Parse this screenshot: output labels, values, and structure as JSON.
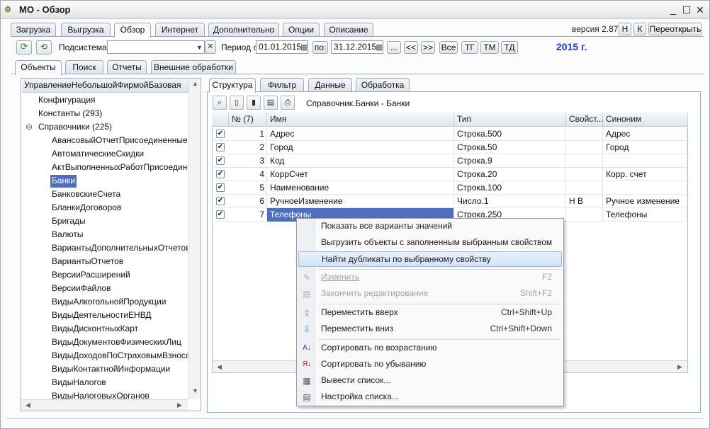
{
  "window": {
    "title": "МО - Обзор",
    "min": "_",
    "max": "☐",
    "close": "✕"
  },
  "top_tabs": [
    "Загрузка",
    "Выгрузка",
    "Обзор",
    "Интернет",
    "Дополнительно",
    "Опции",
    "Описание"
  ],
  "top_tabs_active": 2,
  "version": {
    "label": "версия 2.87",
    "h_button": "Н",
    "k_button": "К",
    "reopen_button": "Переоткрыть"
  },
  "toolbar": {
    "subsystem_label": "Подсистема:",
    "subsystem_value": "",
    "period_label": "Период с:",
    "date_from": "01.01.2015",
    "to_label": "по:",
    "date_to": "31.12.2015",
    "ellipsis": "...",
    "prev": "<<",
    "next": ">>",
    "all": "Все",
    "tg": "ТГ",
    "tm": "ТМ",
    "td": "ТД",
    "year_text": "2015 г."
  },
  "sub_tabs": [
    "Объекты",
    "Поиск",
    "Отчеты",
    "Внешние обработки"
  ],
  "tree": {
    "header": "УправлениеНебольшойФирмойБазовая",
    "root_items": [
      "Конфигурация",
      "Константы (293)",
      "Справочники (225)"
    ],
    "expander": "⊖",
    "children": [
      "АвансовыйОтчетПрисоединенныеФа",
      "АвтоматическиеСкидки",
      "АктВыполненныхРаботПрисоединенн",
      "Банки",
      "БанковскиеСчета",
      "БланкиДоговоров",
      "Бригады",
      "Валюты",
      "ВариантыДополнительныхОтчетов",
      "ВариантыОтчетов",
      "ВерсииРасширений",
      "ВерсииФайлов",
      "ВидыАлкогольнойПродукции",
      "ВидыДеятельностиЕНВД",
      "ВидыДисконтныхКарт",
      "ВидыДокументовФизическихЛиц",
      "ВидыДоходовПоСтраховымВзносам",
      "ВидыКонтактнойИнформации",
      "ВидыНалогов",
      "ВидыНалоговыхОрганов"
    ],
    "selected_index": 3
  },
  "right_tabs": [
    "Структура",
    "Фильтр",
    "Данные",
    "Обработка"
  ],
  "object_path": "Справочник.Банки - Банки",
  "grid": {
    "columns": [
      "№ (7)",
      "Имя",
      "Тип",
      "Свойст...",
      "Синоним"
    ],
    "rows": [
      {
        "n": "1",
        "name": "Адрес",
        "type": "Строка.500",
        "props": "",
        "syn": "Адрес"
      },
      {
        "n": "2",
        "name": "Город",
        "type": "Строка.50",
        "props": "",
        "syn": "Город"
      },
      {
        "n": "3",
        "name": "Код",
        "type": "Строка.9",
        "props": "",
        "syn": ""
      },
      {
        "n": "4",
        "name": "КоррСчет",
        "type": "Строка.20",
        "props": "",
        "syn": "Корр. счет"
      },
      {
        "n": "5",
        "name": "Наименование",
        "type": "Строка.100",
        "props": "",
        "syn": ""
      },
      {
        "n": "6",
        "name": "РучноеИзменение",
        "type": "Число.1",
        "props": "Н В",
        "syn": "Ручное изменение"
      },
      {
        "n": "7",
        "name": "Телефоны",
        "type": "Строка.250",
        "props": "",
        "syn": "Телефоны"
      }
    ],
    "check": "✔"
  },
  "context_menu": {
    "items": [
      {
        "text": "Показать все варианты значений",
        "key": ""
      },
      {
        "text": "Выгрузить объекты с заполненным выбранным свойством",
        "key": ""
      },
      {
        "text": "Найти дубликаты по выбранному свойству",
        "key": ""
      },
      {
        "text": "Изменить",
        "key": "F2"
      },
      {
        "text": "Закончить редактирование",
        "key": "Shift+F2"
      },
      {
        "text": "Переместить вверх",
        "key": "Ctrl+Shift+Up"
      },
      {
        "text": "Переместить вниз",
        "key": "Ctrl+Shift+Down"
      },
      {
        "text": "Сортировать по возрастанию",
        "key": ""
      },
      {
        "text": "Сортировать по убыванию",
        "key": ""
      },
      {
        "text": "Вывести список...",
        "key": ""
      },
      {
        "text": "Настройка списка...",
        "key": ""
      }
    ]
  }
}
